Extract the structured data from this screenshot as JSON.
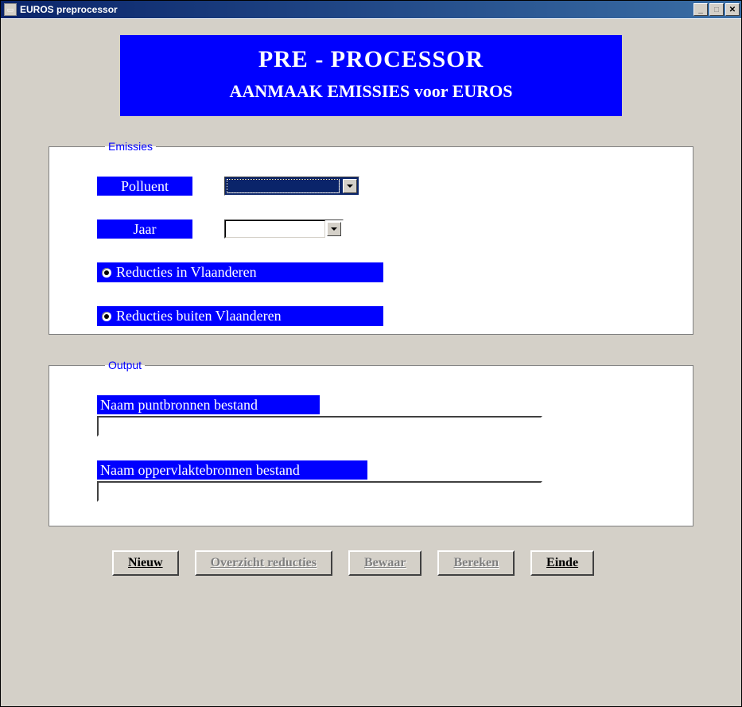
{
  "window": {
    "title": "EUROS preprocessor"
  },
  "banner": {
    "line1": "PRE - PROCESSOR",
    "line2": "AANMAAK EMISSIES voor EUROS"
  },
  "emissies": {
    "legend": "Emissies",
    "polluent_label": "Polluent",
    "polluent_value": "",
    "jaar_label": "Jaar",
    "jaar_value": "",
    "radio_in_vlaanderen": "Reducties in Vlaanderen",
    "radio_buiten_vlaanderen": "Reducties buiten Vlaanderen"
  },
  "output": {
    "legend": "Output",
    "puntbronnen_label": "Naam puntbronnen bestand",
    "puntbronnen_value": "",
    "oppervlakte_label": "Naam oppervlaktebronnen bestand",
    "oppervlakte_value": ""
  },
  "buttons": {
    "nieuw": "Nieuw",
    "overzicht": "Overzicht reducties",
    "bewaar": "Bewaar",
    "bereken": "Bereken",
    "einde": "Einde"
  }
}
